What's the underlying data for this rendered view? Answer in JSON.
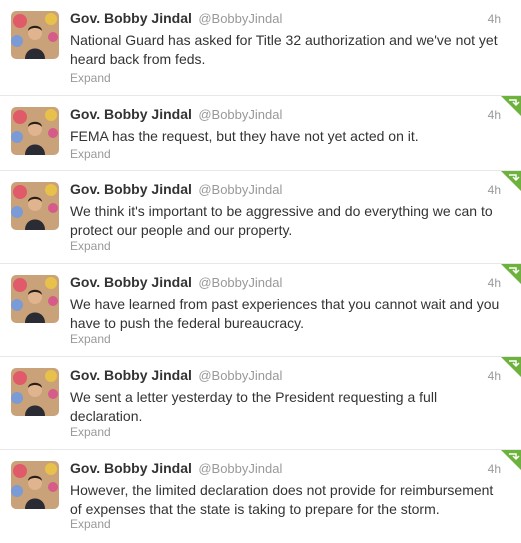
{
  "colors": {
    "retweet_corner": "#6cb23d",
    "link_gray": "#999999",
    "text": "#333333"
  },
  "tweets": [
    {
      "name": "Gov. Bobby Jindal",
      "handle": "@BobbyJindal",
      "time": "4h",
      "lines": [
        "National Guard has asked for Title 32 authorization and we've not yet",
        "heard back from feds."
      ],
      "expand": "Expand",
      "retweeted": false
    },
    {
      "name": "Gov. Bobby Jindal",
      "handle": "@BobbyJindal",
      "time": "4h",
      "lines": [
        "FEMA has the request, but they have not yet acted on it."
      ],
      "expand": "Expand",
      "retweeted": true
    },
    {
      "name": "Gov. Bobby Jindal",
      "handle": "@BobbyJindal",
      "time": "4h",
      "lines": [
        "We think it's important to be aggressive and do everything we can to",
        "protect our people and our property."
      ],
      "expand": "Expand",
      "retweeted": true
    },
    {
      "name": "Gov. Bobby Jindal",
      "handle": "@BobbyJindal",
      "time": "4h",
      "lines": [
        "We have learned from past experiences that you cannot wait and you",
        "have to push the federal bureaucracy."
      ],
      "expand": "Expand",
      "retweeted": true
    },
    {
      "name": "Gov. Bobby Jindal",
      "handle": "@BobbyJindal",
      "time": "4h",
      "lines": [
        "We sent a letter yesterday to the President requesting a full",
        "declaration."
      ],
      "expand": "Expand",
      "retweeted": true
    },
    {
      "name": "Gov. Bobby Jindal",
      "handle": "@BobbyJindal",
      "time": "4h",
      "lines": [
        "However, the limited declaration does not provide for reimbursement",
        "of expenses that the state is taking to prepare for the storm."
      ],
      "expand": "Expand",
      "retweeted": true
    }
  ]
}
